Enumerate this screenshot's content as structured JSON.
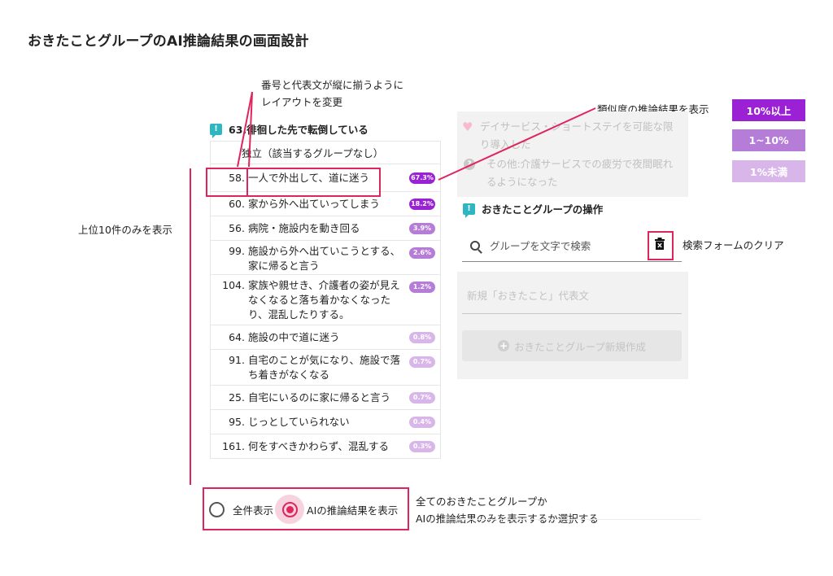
{
  "page_title": "おきたことグループのAI推論結果の画面設計",
  "annotations": {
    "layout_change": [
      "番号と代表文が縦に揃うように",
      "レイアウトを変更"
    ],
    "similarity": "類似度の推論結果を表示",
    "top10": "上位10件のみを表示",
    "clear_search": "検索フォームのクリア",
    "toggle": [
      "全てのおきたことグループか",
      "AIの推論結果のみを表示するか選択する"
    ]
  },
  "legend": [
    {
      "label": "10%以上",
      "color": "#9b22d4"
    },
    {
      "label": "1~10%",
      "color": "#b57cd8"
    },
    {
      "label": "1%未満",
      "color": "#d8b6ea"
    }
  ],
  "group_header": "63.徘徊した先で転倒している",
  "independent": "独立（該当するグループなし）",
  "results": [
    {
      "num": "58.",
      "lines": [
        "一人で外出して、道に迷う"
      ],
      "badge": "67.3%",
      "color": "#9b22d4"
    },
    {
      "num": "60.",
      "lines": [
        "家から外へ出ていってしまう"
      ],
      "badge": "18.2%",
      "color": "#9b22d4"
    },
    {
      "num": "56.",
      "lines": [
        "病院・施設内を動き回る"
      ],
      "badge": "3.9%",
      "color": "#b57cd8"
    },
    {
      "num": "99.",
      "lines": [
        "施設から外へ出ていこうとする、",
        "家に帰ると言う"
      ],
      "badge": "2.6%",
      "color": "#b57cd8"
    },
    {
      "num": "104.",
      "lines": [
        "家族や親せき、介護者の姿が見え",
        "なくなると落ち着かなくなった",
        "り、混乱したりする。"
      ],
      "badge": "1.2%",
      "color": "#b57cd8"
    },
    {
      "num": "64.",
      "lines": [
        "施設の中で道に迷う"
      ],
      "badge": "0.8%",
      "color": "#d8b6ea"
    },
    {
      "num": "91.",
      "lines": [
        "自宅のことが気になり、施設で落",
        "ち着きがなくなる"
      ],
      "badge": "0.7%",
      "color": "#d8b6ea"
    },
    {
      "num": "25.",
      "lines": [
        "自宅にいるのに家に帰ると言う"
      ],
      "badge": "0.7%",
      "color": "#d8b6ea"
    },
    {
      "num": "95.",
      "lines": [
        "じっとしていられない"
      ],
      "badge": "0.4%",
      "color": "#d8b6ea"
    },
    {
      "num": "161.",
      "lines": [
        "何をすべきかわらず、混乱する"
      ],
      "badge": "0.3%",
      "color": "#d8b6ea"
    }
  ],
  "radio": {
    "all": "全件表示",
    "ai": "AIの推論結果を表示"
  },
  "ghost_card": {
    "line1": [
      "デイサービス・ショートステイを可能な限",
      "り導入した"
    ],
    "line2": [
      "その他:介護サービスでの疲労で夜間眠れ",
      "るようになった"
    ]
  },
  "ops_header": "おきたことグループの操作",
  "search_placeholder": "グループを文字で検索",
  "new_input_placeholder": "新規「おきたこと」代表文",
  "create_button": "おきたことグループ新規作成"
}
